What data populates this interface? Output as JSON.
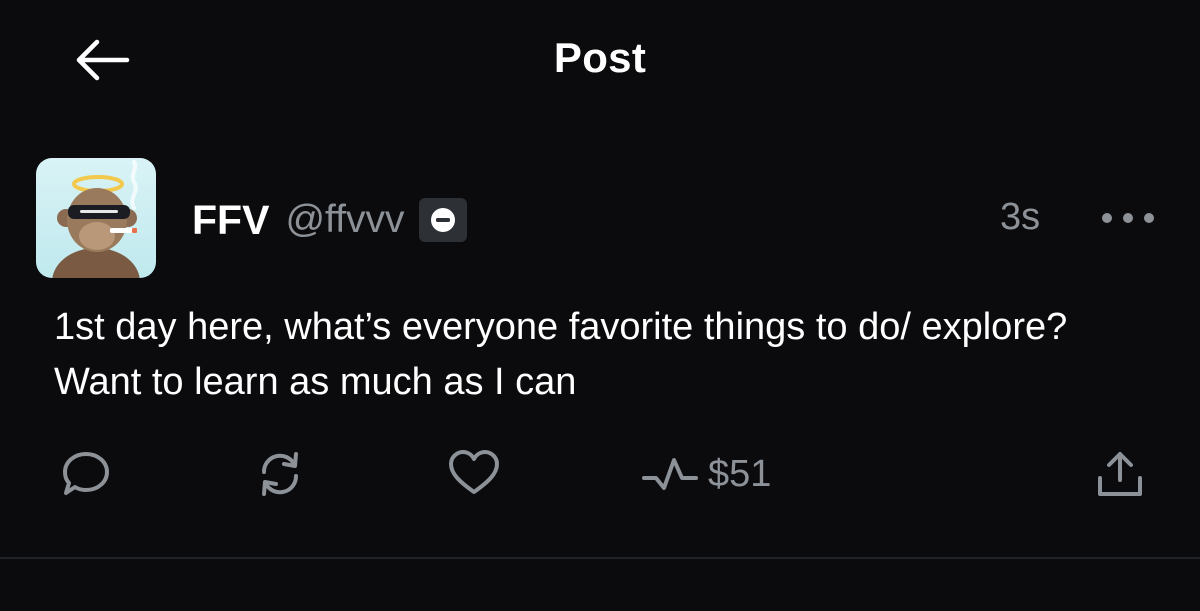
{
  "header": {
    "title": "Post"
  },
  "post": {
    "display_name": "FFV",
    "handle": "@ffvvv",
    "timestamp": "3s",
    "body": "1st day here, what’s everyone favorite things to do/ explore? Want to learn as much as I can",
    "actions": {
      "tips_amount": "$51"
    }
  },
  "icons": {
    "back": "arrow-left-icon",
    "badge": "minus-circle-icon",
    "more": "ellipsis-icon",
    "reply": "speech-bubble-icon",
    "repost": "refresh-icon",
    "like": "heart-icon",
    "tips": "pulse-icon",
    "share": "share-upload-icon"
  },
  "colors": {
    "background": "#0b0b0d",
    "primary_text": "#ffffff",
    "secondary_text": "#8d9299",
    "badge_bg": "#2d3035",
    "divider": "#1f2226"
  }
}
